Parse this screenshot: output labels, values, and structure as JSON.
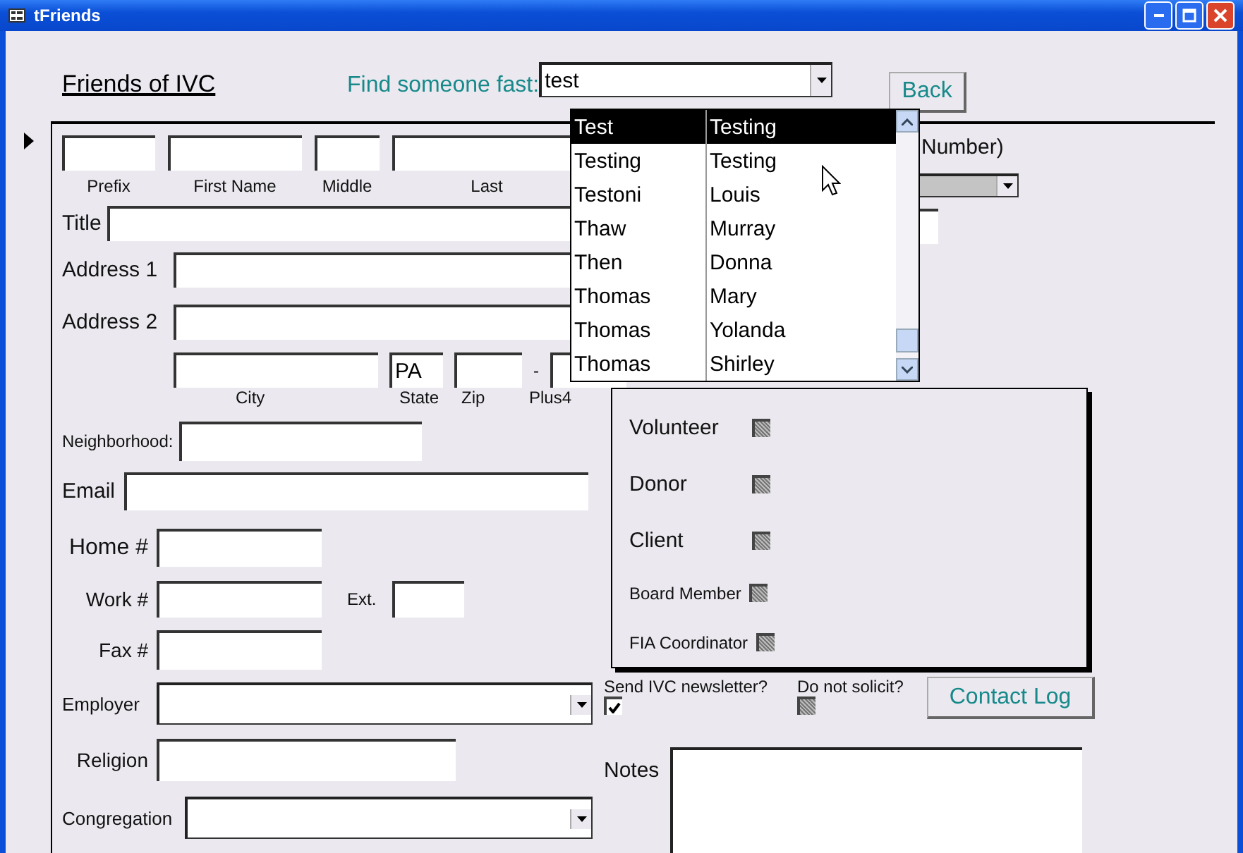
{
  "window": {
    "title": "tFriends"
  },
  "header": {
    "title": "Friends of IVC",
    "search_label": "Find someone fast:",
    "search_value": "test",
    "back_button": "Back"
  },
  "dropdown": {
    "rows": [
      {
        "column_1": "Test",
        "column_2": "Testing",
        "selected": true
      },
      {
        "column_1": "Testing",
        "column_2": "Testing",
        "selected": false
      },
      {
        "column_1": "Testoni",
        "column_2": "Louis",
        "selected": false
      },
      {
        "column_1": "Thaw",
        "column_2": "Murray",
        "selected": false
      },
      {
        "column_1": "Then",
        "column_2": "Donna",
        "selected": false
      },
      {
        "column_1": "Thomas",
        "column_2": "Mary",
        "selected": false
      },
      {
        "column_1": "Thomas",
        "column_2": "Yolanda",
        "selected": false
      },
      {
        "column_1": "Thomas",
        "column_2": "Shirley",
        "selected": false
      }
    ]
  },
  "name_labels": [
    "Prefix",
    "First Name",
    "Middle",
    "Last"
  ],
  "partial_label": "Number)",
  "title_label": "Title",
  "address1_label": "Address 1",
  "address2_label": "Address 2",
  "city_row": {
    "state_value": "PA",
    "zip_separator": "-",
    "city_label": "City",
    "state_label": "State",
    "zip_label": "Zip",
    "plus4_label": "Plus4"
  },
  "neighborhood_label": "Neighborhood:",
  "email_label": "Email",
  "home_label": "Home #",
  "work_label": "Work #",
  "ext_label": "Ext.",
  "fax_label": "Fax #",
  "employer_label": "Employer",
  "religion_label": "Religion",
  "congregation_label": "Congregation",
  "roles": [
    {
      "label": "Volunteer",
      "kind": "large",
      "indeterminate": true
    },
    {
      "label": "Donor",
      "kind": "large",
      "indeterminate": true
    },
    {
      "label": "Client",
      "kind": "large",
      "indeterminate": true
    },
    {
      "label": "Board Member",
      "kind": "small",
      "indeterminate": true
    },
    {
      "label": "FIA Coordinator",
      "kind": "small",
      "indeterminate": true
    }
  ],
  "newsletter": {
    "label": "Send IVC newsletter?",
    "checked": true
  },
  "do_not_solicit": {
    "label": "Do not solicit?",
    "indeterminate": true
  },
  "contact_log_button": "Contact Log",
  "notes_label": "Notes"
}
